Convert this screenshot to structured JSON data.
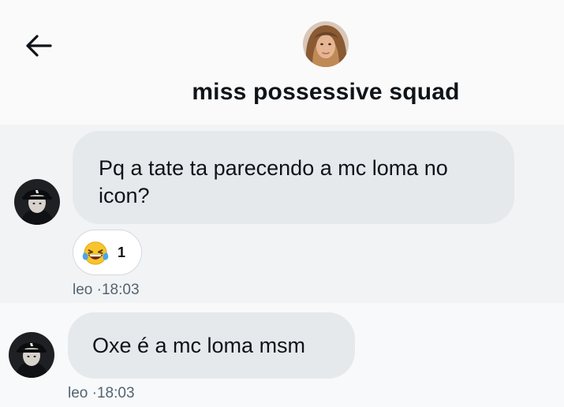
{
  "conversation": {
    "title": "miss possessive squad",
    "back_icon": "back-arrow-icon"
  },
  "messages": [
    {
      "text": "Pq a tate ta parecendo a mc loma no icon?",
      "sender": "leo",
      "time": "18:03",
      "reactions": [
        {
          "emoji": "laughing-with-tears-emoji",
          "count": "1"
        }
      ]
    },
    {
      "text": "Oxe é a mc loma msm",
      "sender": "leo",
      "time": "18:03"
    }
  ],
  "colors": {
    "bubble": "#e6e9ec",
    "text": "#0f1419",
    "secondary_text": "#536471",
    "reaction_border": "#d4d9de"
  }
}
